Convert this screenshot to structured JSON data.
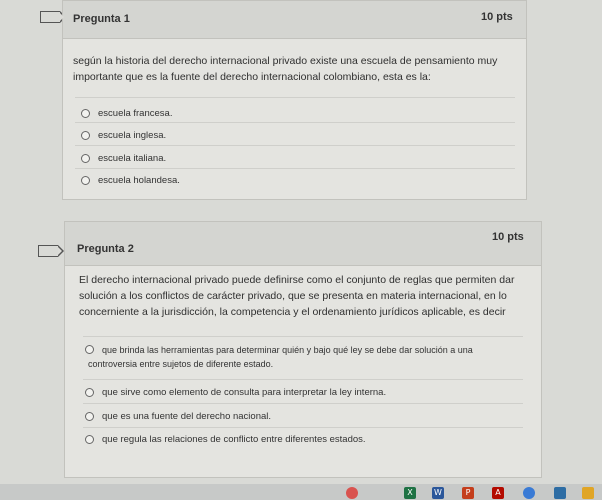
{
  "questions": [
    {
      "title": "Pregunta 1",
      "points": "10 pts",
      "text_lines": [
        "según la historia del derecho internacional privado existe una escuela de pensamiento muy",
        "importante que es la fuente del derecho internacional colombiano, esta es la:"
      ],
      "answers": [
        [
          "escuela francesa."
        ],
        [
          "escuela inglesa."
        ],
        [
          "escuela italiana."
        ],
        [
          "escuela holandesa."
        ]
      ]
    },
    {
      "title": "Pregunta 2",
      "points": "10 pts",
      "text_lines": [
        "El derecho internacional privado puede definirse como el conjunto de reglas que permiten dar",
        "solución a los conflictos de carácter privado, que se presenta en materia internacional, en lo",
        "concerniente a la jurisdicción, la competencia y el ordenamiento jurídicos aplicable, es decir"
      ],
      "answers": [
        [
          "que brinda las herramientas para determinar quién y bajo qué ley se debe dar solución a una",
          "controversia entre sujetos de diferente estado."
        ],
        [
          "que sirve como elemento de consulta para interpretar la ley interna."
        ],
        [
          "que es una fuente del derecho nacional."
        ],
        [
          "que regula las relaciones de conflicto entre diferentes estados."
        ]
      ]
    }
  ],
  "taskbar": {
    "icons": [
      {
        "name": "chrome-icon",
        "color": "#d9534f"
      },
      {
        "name": "excel-icon",
        "color": "#1f7244",
        "glyph": "X"
      },
      {
        "name": "word-icon",
        "color": "#2b579a",
        "glyph": "W"
      },
      {
        "name": "powerpoint-icon",
        "color": "#c43e1c",
        "glyph": "P"
      },
      {
        "name": "acrobat-icon",
        "color": "#b30b00",
        "glyph": "A"
      },
      {
        "name": "app-icon",
        "color": "#3a7bd5"
      },
      {
        "name": "photos-icon",
        "color": "#2e6da4"
      },
      {
        "name": "files-icon",
        "color": "#e0a526"
      }
    ]
  }
}
